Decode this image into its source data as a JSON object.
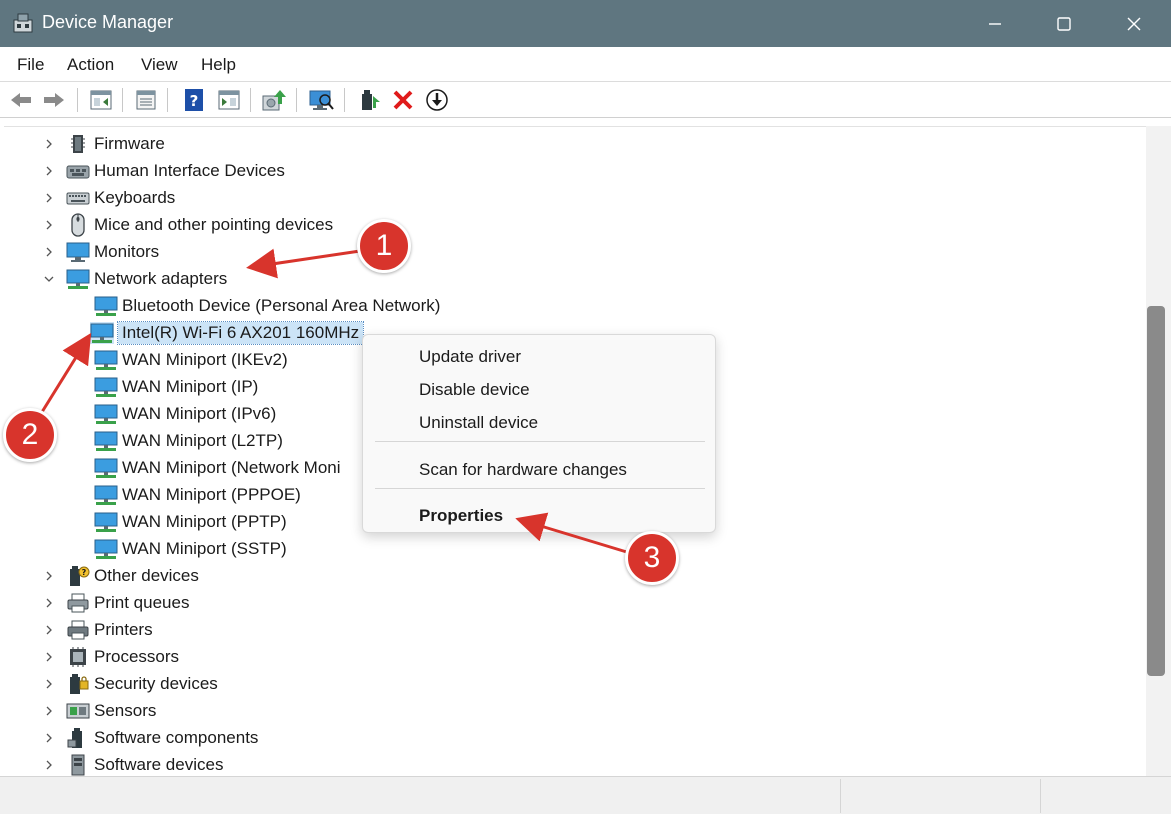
{
  "window": {
    "title": "Device Manager",
    "controls": [
      "minimize-icon",
      "maximize-icon",
      "close-icon"
    ]
  },
  "menubar": {
    "items": [
      "File",
      "Action",
      "View",
      "Help"
    ]
  },
  "toolbar": {
    "buttons": [
      "back-icon",
      "forward-icon",
      "show-hide-tree-icon",
      "properties-icon",
      "help-icon",
      "action-pane-icon",
      "update-driver-icon",
      "scan-hardware-icon",
      "enable-device-icon",
      "uninstall-device-icon",
      "download-driver-icon"
    ]
  },
  "tree": {
    "categories_top": [
      {
        "label": "Firmware",
        "icon": "firmware-icon",
        "expanded": false
      },
      {
        "label": "Human Interface Devices",
        "icon": "hid-icon",
        "expanded": false
      },
      {
        "label": "Keyboards",
        "icon": "keyboard-icon",
        "expanded": false
      },
      {
        "label": "Mice and other pointing devices",
        "icon": "mouse-icon",
        "expanded": false
      },
      {
        "label": "Monitors",
        "icon": "monitor-icon",
        "expanded": false
      },
      {
        "label": "Network adapters",
        "icon": "network-adapter-icon",
        "expanded": true
      }
    ],
    "network_children": [
      "Bluetooth Device (Personal Area Network)",
      "Intel(R) Wi-Fi 6 AX201 160MHz",
      "WAN Miniport (IKEv2)",
      "WAN Miniport (IP)",
      "WAN Miniport (IPv6)",
      "WAN Miniport (L2TP)",
      "WAN Miniport (Network Moni",
      "WAN Miniport (PPPOE)",
      "WAN Miniport (PPTP)",
      "WAN Miniport (SSTP)"
    ],
    "selected_child": "Intel(R) Wi-Fi 6 AX201 160MHz",
    "categories_bottom": [
      {
        "label": "Other devices",
        "icon": "other-devices-icon"
      },
      {
        "label": "Print queues",
        "icon": "print-queue-icon"
      },
      {
        "label": "Printers",
        "icon": "printer-icon"
      },
      {
        "label": "Processors",
        "icon": "processor-icon"
      },
      {
        "label": "Security devices",
        "icon": "security-device-icon"
      },
      {
        "label": "Sensors",
        "icon": "sensor-icon"
      },
      {
        "label": "Software components",
        "icon": "software-component-icon"
      },
      {
        "label": "Software devices",
        "icon": "software-device-icon"
      }
    ]
  },
  "context_menu": {
    "items": [
      "Update driver",
      "Disable device",
      "Uninstall device"
    ],
    "scan": "Scan for hardware changes",
    "properties": "Properties"
  },
  "annotations": {
    "badges": [
      "1",
      "2",
      "3"
    ],
    "color": "#d8342c"
  },
  "colors": {
    "titlebar": "#5f7680",
    "selection": "#cce4f7"
  }
}
